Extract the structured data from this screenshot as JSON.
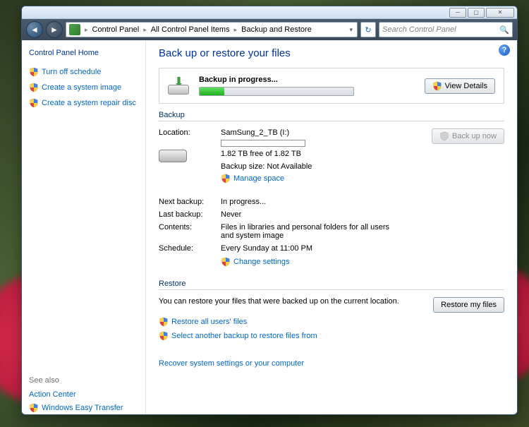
{
  "breadcrumb": {
    "items": [
      "Control Panel",
      "All Control Panel Items",
      "Backup and Restore"
    ]
  },
  "search": {
    "placeholder": "Search Control Panel"
  },
  "sidebar": {
    "home": "Control Panel Home",
    "links": [
      "Turn off schedule",
      "Create a system image",
      "Create a system repair disc"
    ],
    "see_also_label": "See also",
    "see_also": [
      "Action Center",
      "Windows Easy Transfer"
    ]
  },
  "main": {
    "title": "Back up or restore your files",
    "progress": {
      "label": "Backup in progress...",
      "percent": 16,
      "view_details": "View Details"
    },
    "backup_section": {
      "title": "Backup",
      "backup_now": "Back up now",
      "location_label": "Location:",
      "location_name": "SamSung_2_TB (I:)",
      "space_free": "1.82 TB free of 1.82 TB",
      "backup_size": "Backup size: Not Available",
      "manage_space": "Manage space",
      "rows": {
        "next_label": "Next backup:",
        "next_value": "In progress...",
        "last_label": "Last backup:",
        "last_value": "Never",
        "contents_label": "Contents:",
        "contents_value": "Files in libraries and personal folders for all users and system image",
        "schedule_label": "Schedule:",
        "schedule_value": "Every Sunday at 11:00 PM"
      },
      "change_settings": "Change settings"
    },
    "restore_section": {
      "title": "Restore",
      "msg": "You can restore your files that were backed up on the current location.",
      "restore_my_files": "Restore my files",
      "restore_all": "Restore all users' files",
      "select_another": "Select another backup to restore files from",
      "recover": "Recover system settings or your computer"
    }
  }
}
